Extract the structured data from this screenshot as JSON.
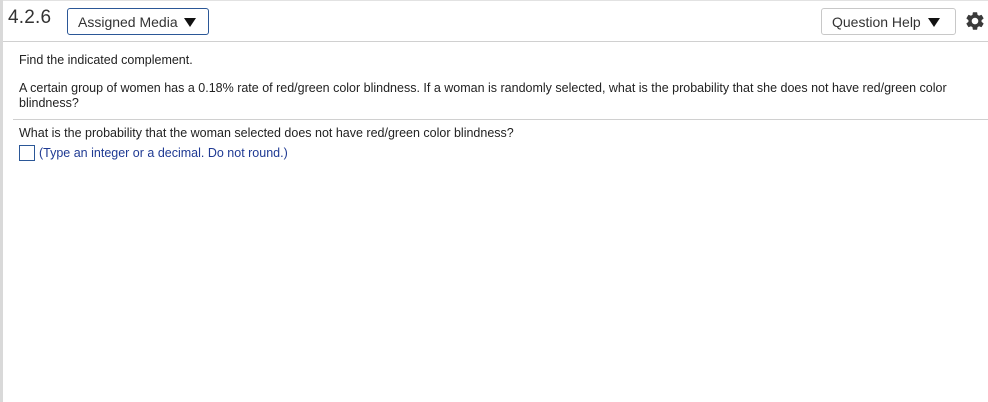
{
  "header": {
    "question_number": "4.2.6",
    "assigned_media_label": "Assigned Media",
    "question_help_label": "Question Help",
    "settings_icon": "gear-icon"
  },
  "content": {
    "instruction": "Find the indicated complement.",
    "problem_text": "A certain group of women has a 0.18% rate of red/green color blindness. If a woman is randomly selected, what is the probability that she does not have red/green color blindness?",
    "question": "What is the probability that the woman selected does not have red/green color blindness?",
    "answer_value": "",
    "answer_hint": "(Type an integer or a decimal. Do not round.)"
  },
  "colors": {
    "accent_border": "#2b5797",
    "hint_text": "#1f3a93"
  }
}
